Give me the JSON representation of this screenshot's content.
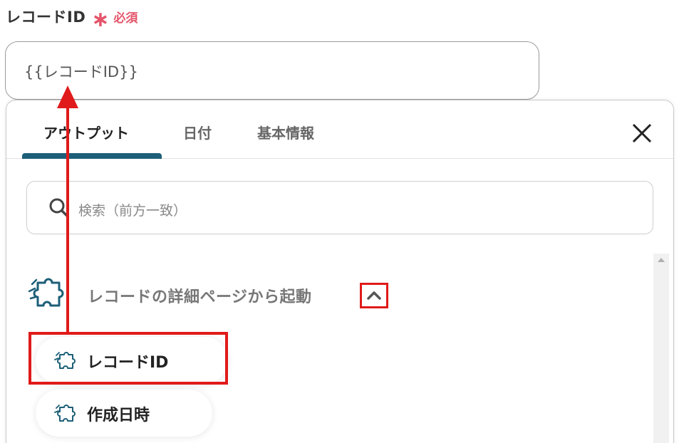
{
  "field": {
    "label": "レコードID",
    "asterisk": "∗",
    "required": "必須",
    "value": "{{レコードID}}"
  },
  "panel": {
    "tabs": [
      {
        "label": "アウトプット",
        "active": true
      },
      {
        "label": "日付",
        "active": false
      },
      {
        "label": "基本情報",
        "active": false
      }
    ],
    "search_placeholder": "検索（前方一致）",
    "group": {
      "title": "レコードの詳細ページから起動",
      "expanded": true
    },
    "items": [
      {
        "label": "レコードID",
        "highlighted": true
      },
      {
        "label": "作成日時",
        "highlighted": false
      }
    ]
  },
  "icons": {
    "close": "close-icon",
    "search": "search-icon",
    "group": "puzzle-icon",
    "chevron": "chevron-up-icon",
    "item": "puzzle-icon"
  },
  "colors": {
    "required": "#e5556a",
    "accent": "#1d5f78",
    "annotation": "#e01a1a"
  }
}
